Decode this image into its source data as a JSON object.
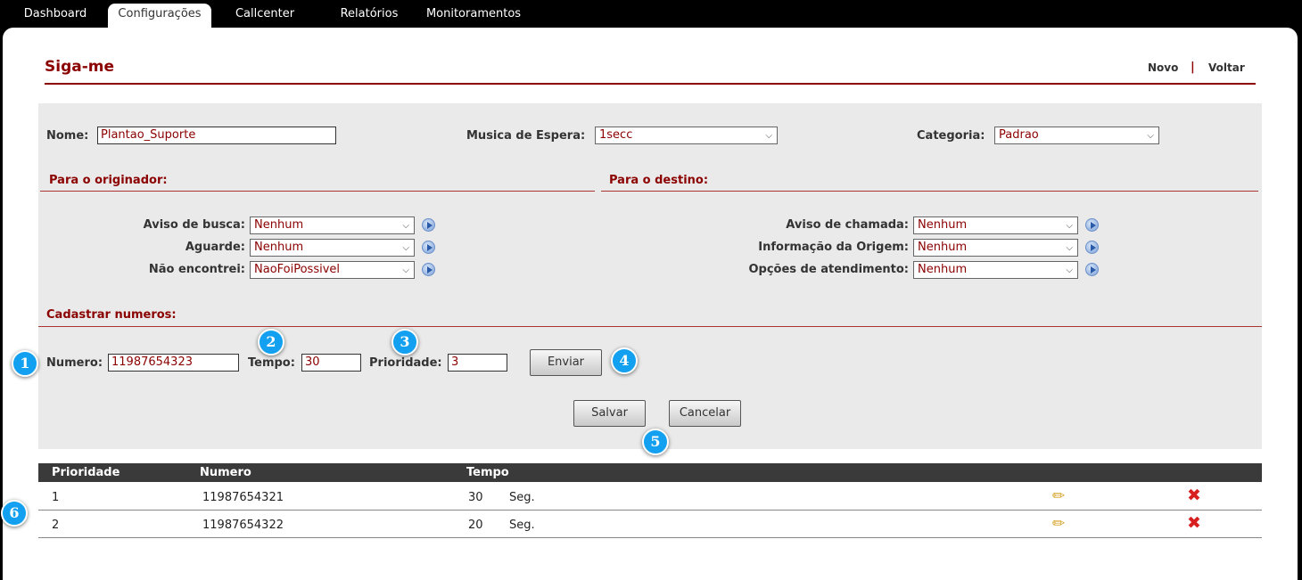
{
  "nav": {
    "tabs": [
      {
        "label": "Dashboard"
      },
      {
        "label": "Configurações",
        "active": true
      },
      {
        "label": "Callcenter"
      },
      {
        "label": "Relatórios"
      },
      {
        "label": "Monitoramentos"
      }
    ]
  },
  "page": {
    "title": "Siga-me",
    "links": {
      "novo": "Novo",
      "separator": "|",
      "voltar": "Voltar"
    }
  },
  "form": {
    "nome": {
      "label": "Nome:",
      "value": "Plantao_Suporte"
    },
    "musica": {
      "label": "Musica de Espera:",
      "value": "1secc"
    },
    "categoria": {
      "label": "Categoria:",
      "value": "Padrao"
    },
    "originador": {
      "heading": "Para o originador:",
      "fields": [
        {
          "label": "Aviso de busca:",
          "value": "Nenhum"
        },
        {
          "label": "Aguarde:",
          "value": "Nenhum"
        },
        {
          "label": "Não encontrei:",
          "value": "NaoFoiPossivel"
        }
      ]
    },
    "destino": {
      "heading": "Para o destino:",
      "fields": [
        {
          "label": "Aviso de chamada:",
          "value": "Nenhum"
        },
        {
          "label": "Informação da Origem:",
          "value": "Nenhum"
        },
        {
          "label": "Opções de atendimento:",
          "value": "Nenhum"
        }
      ]
    },
    "cadastrar": {
      "heading": "Cadastrar numeros:",
      "numero": {
        "label": "Numero:",
        "value": "11987654323"
      },
      "tempo": {
        "label": "Tempo:",
        "value": "30"
      },
      "prioridade": {
        "label": "Prioridade:",
        "value": "3"
      },
      "enviar": "Enviar"
    },
    "salvar": "Salvar",
    "cancelar": "Cancelar"
  },
  "badges": [
    "1",
    "2",
    "3",
    "4",
    "5",
    "6"
  ],
  "table": {
    "headers": [
      "Prioridade",
      "Numero",
      "Tempo"
    ],
    "rows": [
      {
        "prioridade": "1",
        "numero": "11987654321",
        "tempo": "30",
        "unit": "Seg."
      },
      {
        "prioridade": "2",
        "numero": "11987654322",
        "tempo": "20",
        "unit": "Seg."
      }
    ]
  },
  "icons": {
    "edit": "pencil-icon",
    "delete": "delete-x-icon",
    "play": "play-icon",
    "dropdown": "chevron-down-icon"
  }
}
